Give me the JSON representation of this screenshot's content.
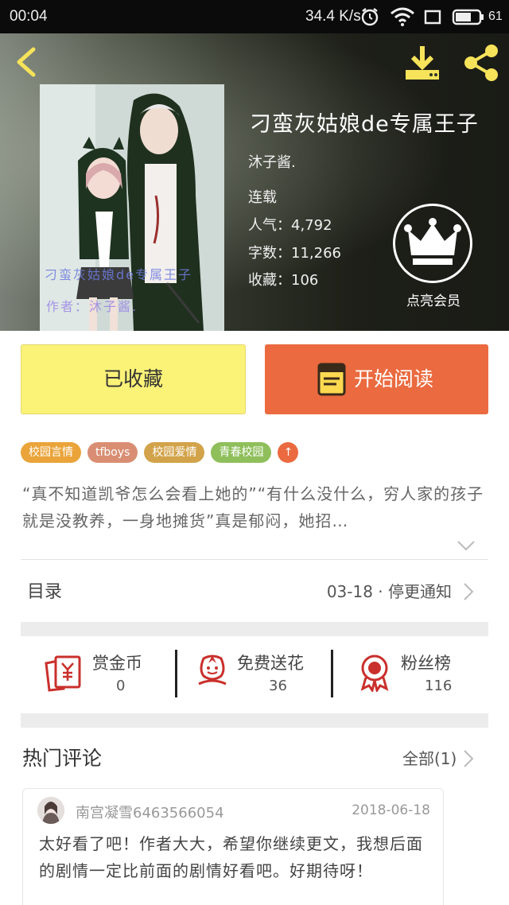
{
  "status_bar": {
    "time": "00:04",
    "speed": "34.4 K/s",
    "battery": "61"
  },
  "book": {
    "title": "刁蛮灰姑娘de专属王子",
    "author": "沐子酱.",
    "status": "连载",
    "popularity": "人气：4,792",
    "word_count": "字数：11,266",
    "favorites": "收藏：106",
    "cover_text_line1": "刁蛮灰姑娘de专属王子",
    "cover_text_line2": "作者：沐子酱."
  },
  "vip": {
    "label": "点亮会员"
  },
  "actions": {
    "favorited_label": "已收藏",
    "read_label": "开始阅读"
  },
  "tags": [
    {
      "label": "校园言情",
      "color": "#eaa43a"
    },
    {
      "label": "tfboys",
      "color": "#d98e73"
    },
    {
      "label": "校园爱情",
      "color": "#d2a34a"
    },
    {
      "label": "青春校园",
      "color": "#8fbf5b"
    },
    {
      "label": "↑",
      "color": "#eb6a3f"
    }
  ],
  "intro": {
    "text": "“真不知道凯爷怎么会看上她的”“有什么没什么，穷人家的孩子就是没教养，一身地摊货”真是郁闷，她招…"
  },
  "toc": {
    "label": "目录",
    "latest": "03-18 · 停更通知"
  },
  "stats": [
    {
      "label": "赏金币",
      "value": "0"
    },
    {
      "label": "免费送花",
      "value": "36"
    },
    {
      "label": "粉丝榜",
      "value": "116"
    }
  ],
  "comments": {
    "title": "热门评论",
    "all_label": "全部(1)",
    "items": [
      {
        "user": "南宫凝雪6463566054",
        "date": "2018-06-18",
        "text": "太好看了吧！作者大大，希望你继续更文，我想后面的剧情一定比前面的剧情好看吧。好期待呀！"
      }
    ]
  },
  "colors": {
    "accent_orange": "#eb6a3f",
    "accent_yellow": "#fbf278",
    "icon_red": "#c9302c",
    "header_icon_yellow": "#f6e35a"
  }
}
